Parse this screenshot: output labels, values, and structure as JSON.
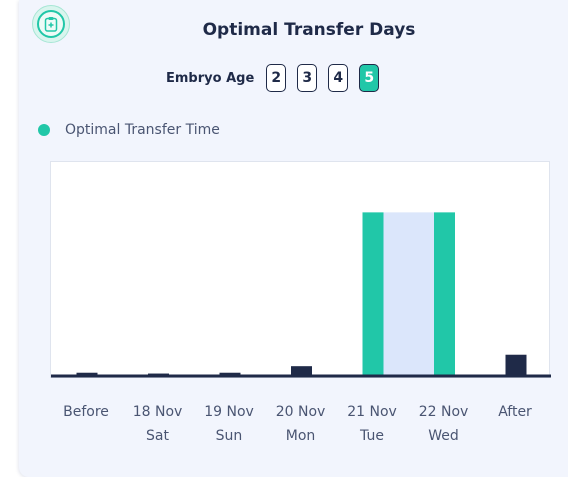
{
  "header": {
    "title": "Optimal Transfer Days",
    "embryo_age_label": "Embryo Age",
    "icon": "clipboard-icon"
  },
  "embryo_age": {
    "options": [
      "2",
      "3",
      "4",
      "5"
    ],
    "selected": "5"
  },
  "colors": {
    "accent": "#21c7a8",
    "bar": "#1f2a48",
    "highlight_band": "#dbe6fb",
    "baseline": "#1f2a48"
  },
  "chart_data": {
    "type": "bar",
    "legend": [
      {
        "name": "Optimal Transfer Time",
        "color": "#21c7a8"
      }
    ],
    "legend_position": "top-left",
    "categories": [
      {
        "line1": "Before",
        "line2": ""
      },
      {
        "line1": "18 Nov",
        "line2": "Sat"
      },
      {
        "line1": "19 Nov",
        "line2": "Sun"
      },
      {
        "line1": "20 Nov",
        "line2": "Mon"
      },
      {
        "line1": "21 Nov",
        "line2": "Tue"
      },
      {
        "line1": "22 Nov",
        "line2": "Wed"
      },
      {
        "line1": "After",
        "line2": ""
      }
    ],
    "values": [
      2,
      1.5,
      2,
      6,
      100,
      100,
      13
    ],
    "optimal": [
      false,
      false,
      false,
      false,
      true,
      true,
      false
    ],
    "highlight_range": [
      "21 Nov",
      "22 Nov"
    ],
    "ylim": [
      0,
      110
    ],
    "grid": false
  }
}
